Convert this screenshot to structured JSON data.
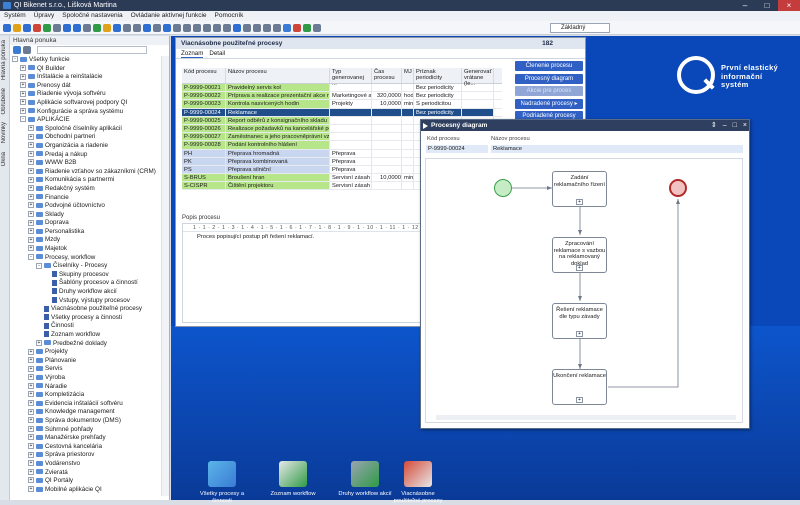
{
  "app": {
    "title": "QI  Bikenet s.r.o., Lišková Martina"
  },
  "menu": [
    "Systém",
    "Úpravy",
    "Spoločné nastavenia",
    "Ovládanie aktívnej funkcie",
    "Pomocník"
  ],
  "toolbar": {
    "combo": "Základný"
  },
  "sidebar": {
    "header": "Hlavná ponuka",
    "vtabs": [
      "Hlavná ponuka",
      "Obľúbené",
      "Novinky",
      "Okná"
    ],
    "tree": [
      {
        "l": "Všetky funkcie",
        "d": 0,
        "ex": "-",
        "t": "f"
      },
      {
        "l": "QI Builder",
        "d": 1,
        "ex": "+",
        "t": "f"
      },
      {
        "l": "Inštalácie a reinštalácie",
        "d": 1,
        "ex": "+",
        "t": "f"
      },
      {
        "l": "Prenosy dát",
        "d": 1,
        "ex": "+",
        "t": "f"
      },
      {
        "l": "Riadenie vývoja softvéru",
        "d": 1,
        "ex": "+",
        "t": "f"
      },
      {
        "l": "Aplikácie softvarovej podpory QI",
        "d": 1,
        "ex": "+",
        "t": "f"
      },
      {
        "l": "Konfigurácie a správa systému",
        "d": 1,
        "ex": "+",
        "t": "f"
      },
      {
        "l": "APLIKÁCIE",
        "d": 1,
        "ex": "-",
        "t": "f"
      },
      {
        "l": "Spoločné číselníky aplikácií",
        "d": 2,
        "ex": "+",
        "t": "f"
      },
      {
        "l": "Obchodní partneri",
        "d": 2,
        "ex": "+",
        "t": "f"
      },
      {
        "l": "Organizácia a riadenie",
        "d": 2,
        "ex": "+",
        "t": "f"
      },
      {
        "l": "Predaj a nákup",
        "d": 2,
        "ex": "+",
        "t": "f"
      },
      {
        "l": "WWW B2B",
        "d": 2,
        "ex": "+",
        "t": "f"
      },
      {
        "l": "Riadenie vzťahov so zákazníkmi (CRM)",
        "d": 2,
        "ex": "+",
        "t": "f"
      },
      {
        "l": "Komunikácia s partnermi",
        "d": 2,
        "ex": "+",
        "t": "f"
      },
      {
        "l": "Redakčný systém",
        "d": 2,
        "ex": "+",
        "t": "f"
      },
      {
        "l": "Financie",
        "d": 2,
        "ex": "+",
        "t": "f"
      },
      {
        "l": "Podvojné účtovníctvo",
        "d": 2,
        "ex": "+",
        "t": "f"
      },
      {
        "l": "Sklady",
        "d": 2,
        "ex": "+",
        "t": "f"
      },
      {
        "l": "Doprava",
        "d": 2,
        "ex": "+",
        "t": "f"
      },
      {
        "l": "Personalistika",
        "d": 2,
        "ex": "+",
        "t": "f"
      },
      {
        "l": "Mzdy",
        "d": 2,
        "ex": "+",
        "t": "f"
      },
      {
        "l": "Majetok",
        "d": 2,
        "ex": "+",
        "t": "f"
      },
      {
        "l": "Procesy, workflow",
        "d": 2,
        "ex": "-",
        "t": "f"
      },
      {
        "l": "Číselníky - Procesy",
        "d": 3,
        "ex": "-",
        "t": "f"
      },
      {
        "l": "Skupiny procesov",
        "d": 4,
        "ex": "",
        "t": "d"
      },
      {
        "l": "Šablóny procesov a činností",
        "d": 4,
        "ex": "",
        "t": "d"
      },
      {
        "l": "Druhy workflow akcií",
        "d": 4,
        "ex": "",
        "t": "d"
      },
      {
        "l": "Vstupy, výstupy procesov",
        "d": 4,
        "ex": "",
        "t": "d"
      },
      {
        "l": "Viacnásobne použiteľné procesy",
        "d": 3,
        "ex": "",
        "t": "d"
      },
      {
        "l": "Všetky procesy a činnosti",
        "d": 3,
        "ex": "",
        "t": "d"
      },
      {
        "l": "Činnosti",
        "d": 3,
        "ex": "",
        "t": "d"
      },
      {
        "l": "Zoznam workflow",
        "d": 3,
        "ex": "",
        "t": "d"
      },
      {
        "l": "Predbežné doklady",
        "d": 3,
        "ex": "+",
        "t": "f"
      },
      {
        "l": "Projekty",
        "d": 2,
        "ex": "+",
        "t": "f"
      },
      {
        "l": "Plánovanie",
        "d": 2,
        "ex": "+",
        "t": "f"
      },
      {
        "l": "Servis",
        "d": 2,
        "ex": "+",
        "t": "f"
      },
      {
        "l": "Výroba",
        "d": 2,
        "ex": "+",
        "t": "f"
      },
      {
        "l": "Náradie",
        "d": 2,
        "ex": "+",
        "t": "f"
      },
      {
        "l": "Kompletizácia",
        "d": 2,
        "ex": "+",
        "t": "f"
      },
      {
        "l": "Evidencia inštalácií softvéru",
        "d": 2,
        "ex": "+",
        "t": "f"
      },
      {
        "l": "Knowledge management",
        "d": 2,
        "ex": "+",
        "t": "f"
      },
      {
        "l": "Správa dokumentov (DMS)",
        "d": 2,
        "ex": "+",
        "t": "f"
      },
      {
        "l": "Súhrnné pohľady",
        "d": 2,
        "ex": "+",
        "t": "f"
      },
      {
        "l": "Manažérske prehľady",
        "d": 2,
        "ex": "+",
        "t": "f"
      },
      {
        "l": "Cestovná kancelária",
        "d": 2,
        "ex": "+",
        "t": "f"
      },
      {
        "l": "Správa priestorov",
        "d": 2,
        "ex": "+",
        "t": "f"
      },
      {
        "l": "Vodárenstvo",
        "d": 2,
        "ex": "+",
        "t": "f"
      },
      {
        "l": "Zvieratá",
        "d": 2,
        "ex": "+",
        "t": "f"
      },
      {
        "l": "QI Portály",
        "d": 2,
        "ex": "+",
        "t": "f"
      },
      {
        "l": "Mobilné aplikácie QI",
        "d": 2,
        "ex": "+",
        "t": "f"
      }
    ]
  },
  "win1": {
    "title": "Viacnásobne použiteľné procesy",
    "count": "182",
    "tabs": [
      "Zoznam",
      "Detail"
    ],
    "headers": [
      "Kód procesu",
      "Názov procesu",
      "Typ generovanej ...",
      "Čas procesu",
      "MJ",
      "Príznak periodicity",
      "Generovať vrátane (le..."
    ],
    "rows": [
      {
        "kod": "P-9999-00021",
        "nazov": "Pravidelný servis kol",
        "typ": "",
        "cas": "",
        "mj": "",
        "per": "Bez periodicity",
        "bg": "#b7e68a"
      },
      {
        "kod": "P-9999-00022",
        "nazov": "Príprava a realizace prezentační akce novem",
        "typ": "Marketingové akc",
        "cas": "320,0000",
        "mj": "hod",
        "per": "Bez periodicity",
        "bg": "#b7e68a"
      },
      {
        "kod": "P-9999-00023",
        "nazov": "Kontrola nasvícených hodin",
        "typ": "Projekty",
        "cas": "10,0000",
        "mj": "min",
        "per": "S periodicitou",
        "bg": "#b7e68a"
      },
      {
        "kod": "P-9999-00024",
        "nazov": "Reklamace",
        "typ": "",
        "cas": "",
        "mj": "",
        "per": "Bez periodicity",
        "bg": "#1f4e8a",
        "sel": true
      },
      {
        "kod": "P-9999-00025",
        "nazov": "Report odběrů z konsignačního skladu",
        "typ": "",
        "cas": "",
        "mj": "",
        "per": "",
        "bg": "#b7e68a"
      },
      {
        "kod": "P-9999-00026",
        "nazov": "Realizace požadavků na kancelářské potřeby",
        "typ": "",
        "cas": "",
        "mj": "",
        "per": "",
        "bg": "#b7e68a"
      },
      {
        "kod": "P-9999-00027",
        "nazov": "Zaměstnanec a jeho pracovněprávní vztahy",
        "typ": "",
        "cas": "",
        "mj": "",
        "per": "",
        "bg": "#b7e68a"
      },
      {
        "kod": "P-9999-00028",
        "nazov": "Podání kontrolního hlášení",
        "typ": "",
        "cas": "",
        "mj": "",
        "per": "",
        "bg": "#b7e68a"
      },
      {
        "kod": "PH",
        "nazov": "Přeprava hromadná",
        "typ": "Přeprava",
        "cas": "",
        "mj": "",
        "per": "",
        "bg": "#c9d6ef"
      },
      {
        "kod": "PK",
        "nazov": "Přeprava kombinovaná",
        "typ": "Přeprava",
        "cas": "",
        "mj": "",
        "per": "",
        "bg": "#c9d6ef"
      },
      {
        "kod": "PS",
        "nazov": "Přeprava silniční",
        "typ": "Přeprava",
        "cas": "",
        "mj": "",
        "per": "",
        "bg": "#c9d6ef"
      },
      {
        "kod": "S-BRUS",
        "nazov": "Broušení hran",
        "typ": "Servisní zásah",
        "cas": "10,0000",
        "mj": "min",
        "per": "",
        "bg": "#b7e68a"
      },
      {
        "kod": "S-CISPR",
        "nazov": "Čištění projektoru",
        "typ": "Servisní zásah",
        "cas": "",
        "mj": "",
        "per": "",
        "bg": "#b7e68a"
      }
    ],
    "buttons": [
      {
        "label": "Členenie procesu",
        "dis": false
      },
      {
        "label": "Procesný diagram",
        "dis": false
      },
      {
        "label": "Akcie pre proces",
        "dis": true
      },
      {
        "label": "Nadradené procesy ▸",
        "dis": false
      },
      {
        "label": "Podriadené procesy",
        "dis": false
      }
    ],
    "popis_label": "Popis procesu",
    "ruler": "1 · 1 · 2 · 1 · 3 · 1 · 4 · 1 · 5 · 1 · 6 · 1 · 7 · 1 · 8 · 1 · 9 · 1 · 10 · 1 · 11 · 1 · 12",
    "popis_text": "Proces popisující postup při řešení reklamací."
  },
  "win2": {
    "title": "Procesný diagram",
    "kod_label": "Kód procesu",
    "nazov_label": "Názov procesu",
    "kod": "P-9999-00024",
    "nazov": "Reklamace",
    "tasks": [
      "Zadání reklamačního řízení",
      "Zpracování reklamace s vazbou na reklamovaný doklad",
      "Řešení reklamace dle typu závady",
      "Ukončení reklamace"
    ]
  },
  "brand": {
    "lines": [
      "První elastický",
      "informační",
      "systém"
    ]
  },
  "desktop_icons": [
    "Všetky procesy a činnosti",
    "Zoznam workflow",
    "Druhy workflow akcií",
    "Viacnásobne použiteľné procesy"
  ]
}
